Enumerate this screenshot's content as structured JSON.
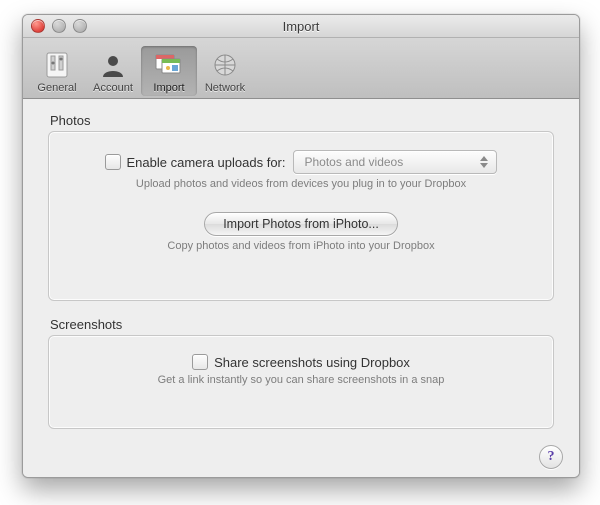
{
  "window": {
    "title": "Import"
  },
  "toolbar": {
    "items": [
      {
        "label": "General",
        "selected": false
      },
      {
        "label": "Account",
        "selected": false
      },
      {
        "label": "Import",
        "selected": true
      },
      {
        "label": "Network",
        "selected": false
      }
    ]
  },
  "photos": {
    "legend": "Photos",
    "enable_label": "Enable camera uploads for:",
    "enable_checked": false,
    "select_value": "Photos and videos",
    "upload_hint": "Upload photos and videos from devices you plug in to your Dropbox",
    "import_button": "Import Photos from iPhoto...",
    "import_hint": "Copy photos and videos from iPhoto into your Dropbox"
  },
  "screenshots": {
    "legend": "Screenshots",
    "share_label": "Share screenshots using Dropbox",
    "share_checked": false,
    "hint": "Get a link instantly so you can share screenshots in a snap"
  },
  "help_glyph": "?"
}
